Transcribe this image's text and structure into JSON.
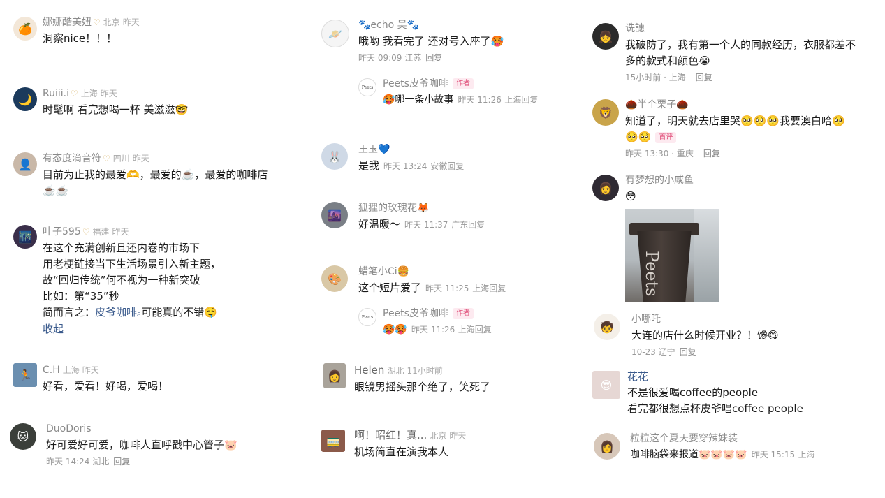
{
  "columns": [
    {
      "comments": [
        {
          "name": "娜娜酷美妞",
          "badge": "♡",
          "location": "北京",
          "time": "昨天",
          "text": "洞察nice！！！",
          "avatar": "🍊",
          "avatar_bg": "#f3e7d8"
        },
        {
          "name": "Ruiii.i",
          "badge": "♡",
          "location": "上海",
          "time": "昨天",
          "text": "时髦啊 看完想喝一杯 美滋滋🤓",
          "avatar": "🌙",
          "avatar_bg": "#1b3a5c"
        },
        {
          "name": "有态度滴音符",
          "badge": "♡",
          "location": "四川",
          "time": "昨天",
          "lines": [
            "目前为止我的最爱🫶，最爱的☕️，最爱的咖啡店",
            "☕️☕️"
          ],
          "avatar": "👤",
          "avatar_bg": "#c9b8a8"
        },
        {
          "name": "叶子595",
          "badge": "♡",
          "location": "福建",
          "time": "昨天",
          "lines": [
            "在这个充满创新且还内卷的市场下",
            "用老梗链接当下生活场景引入新主题，",
            "故“回归传统”何不视为一种新突破",
            "比如：第“35”秒"
          ],
          "last_prefix": "简而言之：",
          "last_link": "皮爷咖啡",
          "last_search": "⌕",
          "last_suffix": "可能真的不错🤤",
          "collapse": "收起",
          "avatar": "🌃",
          "avatar_bg": "#3a2f4a"
        },
        {
          "name": "C.H",
          "location": "上海",
          "time": "昨天",
          "text": "好看，爱看！好喝，爱喝！",
          "avatar": "🏃",
          "avatar_bg": "#6b8fb0"
        },
        {
          "name": "DuoDoris",
          "text": "好可爱好可爱，咖啡人直呼戳中心管子🐷",
          "date": "昨天 14:24",
          "location2": "湖北",
          "reply": "回复",
          "avatar": "🐱",
          "avatar_bg": "#3b3f3a"
        }
      ]
    },
    {
      "comments": [
        {
          "name": "🐾echo 吴🐾",
          "text": "哦哟 我看完了 还对号入座了🥵",
          "date": "昨天 09:09",
          "location2": "江苏",
          "reply": "回复",
          "avatar": "🪐",
          "avatar_bg": "#f5f5f5",
          "sub_reply": {
            "name": "Peets皮爷咖啡",
            "tag": "作者",
            "text": "🥵哪一条小故事",
            "date": "昨天 11:26",
            "location2": "上海",
            "reply": "回复",
            "avatar": "Peets"
          }
        },
        {
          "name": "王玉💙",
          "text": "是我",
          "date": "昨天 13:24",
          "location2": "安徽",
          "reply": "回复",
          "avatar": "🐰",
          "avatar_bg": "#cfd9e6"
        },
        {
          "name": "狐狸的玫瑰花🦊",
          "text": "好温暖～",
          "date": "昨天 11:37",
          "location2": "广东",
          "reply": "回复",
          "avatar": "🌆",
          "avatar_bg": "#7a7f86"
        },
        {
          "name": "蜡笔小Ci🍔",
          "text": "这个短片爱了",
          "date": "昨天 11:25",
          "location2": "上海",
          "reply": "回复",
          "avatar": "🎨",
          "avatar_bg": "#d9c8a6",
          "sub_reply": {
            "name": "Peets皮爷咖啡",
            "tag": "作者",
            "text": "🥵🥵",
            "date": "昨天 11:26",
            "location2": "上海",
            "reply": "回复",
            "avatar": "Peets"
          }
        },
        {
          "name": "Helen",
          "location": "湖北",
          "time": "11小时前",
          "text": "眼镜男摇头那个绝了，笑死了",
          "avatar": "👩",
          "avatar_bg": "#a9a39a"
        },
        {
          "name": "啊！昭红！真...",
          "location": "北京",
          "time": "昨天",
          "text": "机场简直在演我本人",
          "avatar": "🚃",
          "avatar_bg": "#8b5a4a"
        }
      ]
    },
    {
      "comments": [
        {
          "name": "诜譓",
          "lines": [
            "我破防了，我有第一个人的同款经历，衣服都差不",
            "多的款式和颜色😭"
          ],
          "date": "15小时前 · 上海",
          "reply": "回复",
          "avatar": "👧",
          "avatar_bg": "#2b2b2b"
        },
        {
          "name": "🌰半个栗子🌰",
          "lines": [
            "知道了，明天就去店里哭🥺🥺🥺我要澳白哈🥺",
            "🥺🥺"
          ],
          "first_tag": "首评",
          "date": "昨天 13:30 · 重庆",
          "reply": "回复",
          "avatar": "🦁",
          "avatar_bg": "#c9a44a"
        },
        {
          "name": "有梦想的小咸鱼",
          "text": "😳",
          "has_photo": true,
          "photo_text": "Peets",
          "avatar": "👩",
          "avatar_bg": "#2f2a33"
        },
        {
          "name": "小哪吒",
          "text": "大连的店什么时候开业？！馋😋",
          "date": "10-23 辽宁",
          "reply": "回复",
          "avatar": "🧒",
          "avatar_bg": "#f4efe8"
        },
        {
          "name": "花花",
          "name_style": "dark",
          "lines": [
            "不是很爱喝coffee的people",
            "看完都很想点杯皮爷唱coffee people"
          ],
          "avatar": "😎",
          "avatar_bg": "#e6d7d4"
        },
        {
          "name": "粒粒这个夏天要穿辣妹装",
          "text": "咖啡脑袋来报道🐷🐷🐷🐷",
          "date": "昨天 15:15",
          "location2": "上海",
          "avatar": "👩",
          "avatar_bg": "#d7c7b9"
        }
      ]
    }
  ]
}
